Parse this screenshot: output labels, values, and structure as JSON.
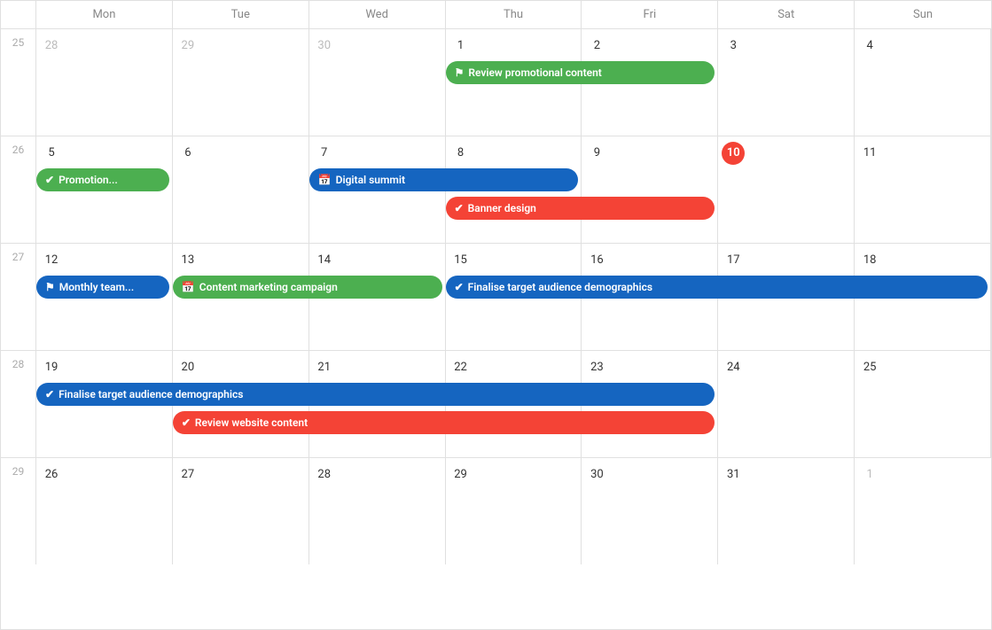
{
  "calendar": {
    "headers": [
      "Mon",
      "Tue",
      "Wed",
      "Thu",
      "Fri",
      "Sat",
      "Sun"
    ],
    "weeks": [
      {
        "weekNum": 25,
        "days": [
          {
            "num": 28,
            "outside": true
          },
          {
            "num": 29,
            "outside": true
          },
          {
            "num": 30,
            "outside": true
          },
          {
            "num": 1,
            "outside": false
          },
          {
            "num": 2,
            "outside": false
          },
          {
            "num": 3,
            "outside": false
          },
          {
            "num": 4,
            "outside": false
          }
        ],
        "events": [
          {
            "label": "Review promotional content",
            "color": "green",
            "icon": "flag",
            "startCol": 3,
            "endCol": 5,
            "topOffset": 36
          }
        ]
      },
      {
        "weekNum": 26,
        "days": [
          {
            "num": 5,
            "outside": false
          },
          {
            "num": 6,
            "outside": false
          },
          {
            "num": 7,
            "outside": false
          },
          {
            "num": 8,
            "outside": false
          },
          {
            "num": 9,
            "outside": false
          },
          {
            "num": 10,
            "outside": false,
            "today": true
          },
          {
            "num": 11,
            "outside": false
          }
        ],
        "events": [
          {
            "label": "Promotion...",
            "color": "green",
            "icon": "check",
            "startCol": 0,
            "endCol": 1,
            "topOffset": 36
          },
          {
            "label": "Digital summit",
            "color": "blue",
            "icon": "calendar",
            "startCol": 2,
            "endCol": 4,
            "topOffset": 36
          },
          {
            "label": "Banner design",
            "color": "red",
            "icon": "check",
            "startCol": 3,
            "endCol": 5,
            "topOffset": 68
          }
        ]
      },
      {
        "weekNum": 27,
        "days": [
          {
            "num": 12,
            "outside": false
          },
          {
            "num": 13,
            "outside": false
          },
          {
            "num": 14,
            "outside": false
          },
          {
            "num": 15,
            "outside": false
          },
          {
            "num": 16,
            "outside": false
          },
          {
            "num": 17,
            "outside": false
          },
          {
            "num": 18,
            "outside": false
          }
        ],
        "events": [
          {
            "label": "Monthly team...",
            "color": "blue",
            "icon": "flag",
            "startCol": 0,
            "endCol": 1,
            "topOffset": 36
          },
          {
            "label": "Content marketing campaign",
            "color": "green",
            "icon": "calendar",
            "startCol": 1,
            "endCol": 3,
            "topOffset": 36
          },
          {
            "label": "Finalise target audience demographics",
            "color": "blue",
            "icon": "check",
            "startCol": 3,
            "endCol": 7,
            "topOffset": 36
          }
        ]
      },
      {
        "weekNum": 28,
        "days": [
          {
            "num": 19,
            "outside": false
          },
          {
            "num": 20,
            "outside": false
          },
          {
            "num": 21,
            "outside": false
          },
          {
            "num": 22,
            "outside": false
          },
          {
            "num": 23,
            "outside": false
          },
          {
            "num": 24,
            "outside": false
          },
          {
            "num": 25,
            "outside": false
          }
        ],
        "events": [
          {
            "label": "Finalise target audience demographics",
            "color": "blue",
            "icon": "check",
            "startCol": 0,
            "endCol": 5,
            "topOffset": 36
          },
          {
            "label": "Review website content",
            "color": "red",
            "icon": "check",
            "startCol": 1,
            "endCol": 5,
            "topOffset": 68
          }
        ]
      },
      {
        "weekNum": 29,
        "days": [
          {
            "num": 26,
            "outside": false
          },
          {
            "num": 27,
            "outside": false
          },
          {
            "num": 28,
            "outside": false
          },
          {
            "num": 29,
            "outside": false
          },
          {
            "num": 30,
            "outside": false
          },
          {
            "num": 31,
            "outside": false
          },
          {
            "num": 1,
            "outside": true
          }
        ],
        "events": []
      }
    ]
  }
}
